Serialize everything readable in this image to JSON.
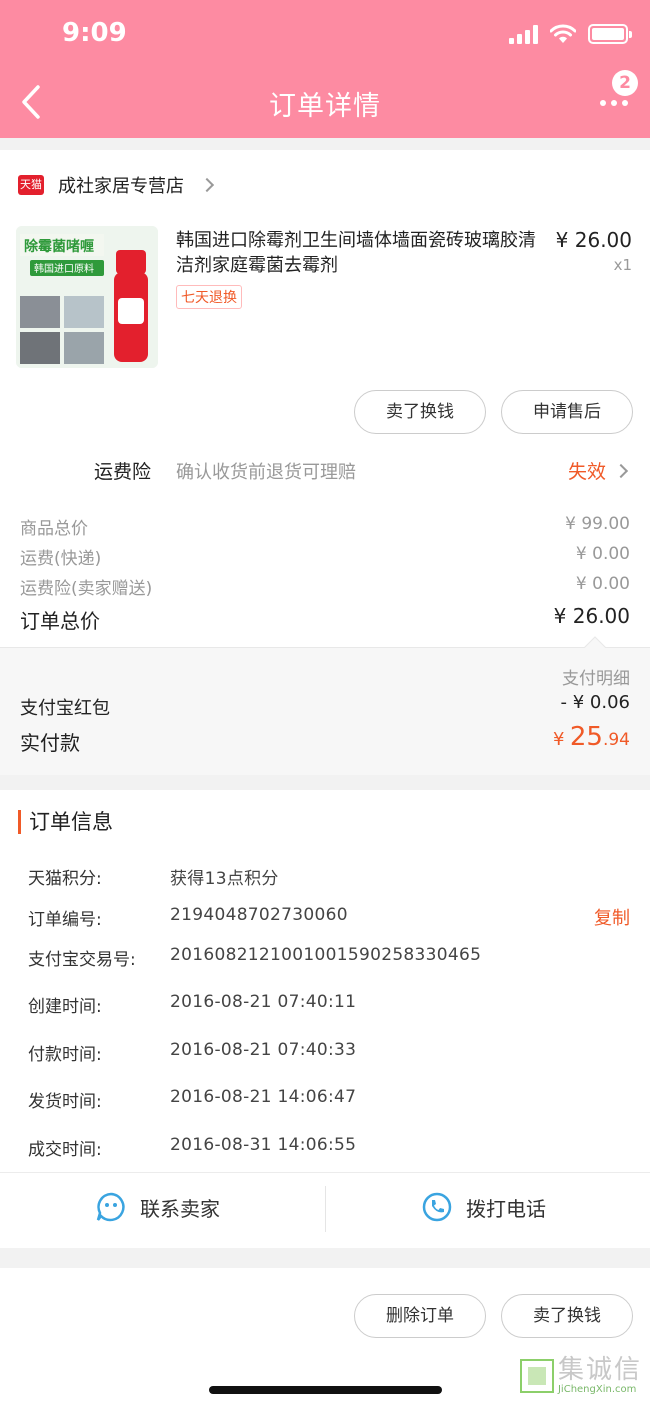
{
  "status": {
    "time": "9:09"
  },
  "header": {
    "title": "订单详情",
    "badge": "2"
  },
  "store": {
    "badge": "天猫",
    "name": "成社家居专营店"
  },
  "product": {
    "title": "韩国进口除霉剂卫生间墙体墙面瓷砖玻璃胶清洁剂家庭霉菌去霉剂",
    "tag": "七天退换",
    "price": "¥ 26.00",
    "qty": "x1",
    "image_text_top": "除霉菌啫喱",
    "image_text_sub": "韩国进口原料"
  },
  "actions": {
    "sell": "卖了换钱",
    "aftersale": "申请售后"
  },
  "freight": {
    "label": "运费险",
    "desc": "确认收货前退货可理赔",
    "status": "失效"
  },
  "summary": {
    "goods_label": "商品总价",
    "goods_value": "¥ 99.00",
    "shipping_label": "运费(快递)",
    "shipping_value": "¥ 0.00",
    "insurance_label": "运费险(卖家赠送)",
    "insurance_value": "¥ 0.00",
    "total_label": "订单总价",
    "total_value": "¥ 26.00"
  },
  "payment": {
    "detail_label": "支付明细",
    "redpack_label": "支付宝红包",
    "redpack_value": "- ¥ 0.06",
    "paid_label": "实付款",
    "paid_symbol": "¥",
    "paid_int": "25",
    "paid_dec": ".94"
  },
  "order_info": {
    "title": "订单信息",
    "copy": "复制",
    "rows": [
      {
        "label": "天猫积分:",
        "value": "获得13点积分"
      },
      {
        "label": "订单编号:",
        "value": "2194048702730060"
      },
      {
        "label": "支付宝交易号:",
        "value": "2016082121001001590258330465"
      },
      {
        "label": "创建时间:",
        "value": "2016-08-21 07:40:11"
      },
      {
        "label": "付款时间:",
        "value": "2016-08-21 07:40:33"
      },
      {
        "label": "发货时间:",
        "value": "2016-08-21 14:06:47"
      },
      {
        "label": "成交时间:",
        "value": "2016-08-31 14:06:55"
      }
    ]
  },
  "contact": {
    "seller": "联系卖家",
    "phone": "拨打电话"
  },
  "bottom": {
    "delete": "删除订单",
    "sell": "卖了换钱"
  },
  "watermark": {
    "text": "集诚信",
    "url": "JiChengXin.com"
  },
  "colors": {
    "header": "#fd8ba2",
    "accent": "#f05a28",
    "contact_icon": "#3aa4e0"
  }
}
